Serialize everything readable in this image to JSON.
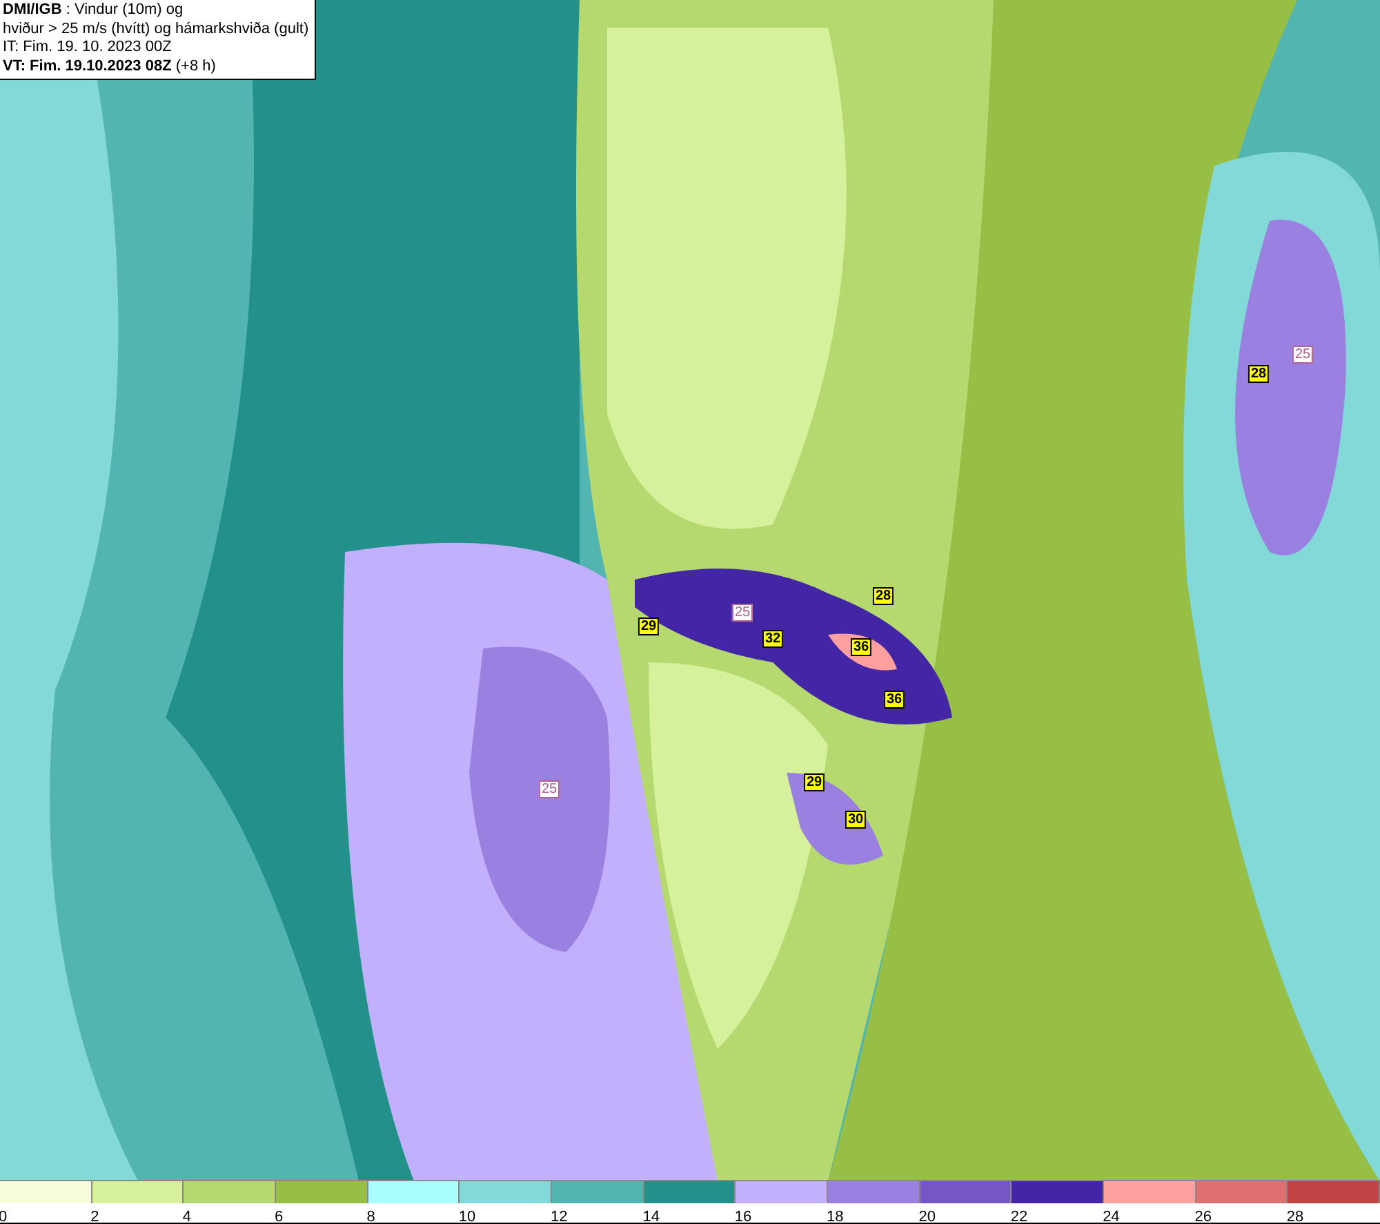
{
  "header": {
    "lines": [
      "**DMI/IGB** : Vindur (10m) og",
      "hviður > 25 m/s (hvítt) og hámarkshviða (gult)",
      "IT: Fim. 19. 10. 2023 00Z",
      "**VT: Fim. 19.10.2023 08Z** (+8 h)"
    ]
  },
  "map": {
    "gust_labels": [
      {
        "kind": "max",
        "text": "28"
      },
      {
        "kind": "gust",
        "text": "25"
      },
      {
        "kind": "max",
        "text": "28"
      },
      {
        "kind": "gust",
        "text": "25"
      },
      {
        "kind": "max",
        "text": "29"
      },
      {
        "kind": "max",
        "text": "32"
      },
      {
        "kind": "max",
        "text": "36"
      },
      {
        "kind": "max",
        "text": "36"
      },
      {
        "kind": "max",
        "text": "29"
      },
      {
        "kind": "gust",
        "text": "25"
      },
      {
        "kind": "max",
        "text": "30"
      }
    ]
  },
  "legend": {
    "swatches": [
      {
        "color": "#f7fcdc"
      },
      {
        "color": "#d7f09c"
      },
      {
        "color": "#b5d96e"
      },
      {
        "color": "#97bf45"
      },
      {
        "color": "#a9fdfc"
      },
      {
        "color": "#83d9d8"
      },
      {
        "color": "#52b5b0"
      },
      {
        "color": "#24908a"
      },
      {
        "color": "#c2b0fc"
      },
      {
        "color": "#9a80e0"
      },
      {
        "color": "#7556c4"
      },
      {
        "color": "#4326a6"
      },
      {
        "color": "#ffa0a0"
      },
      {
        "color": "#e07070"
      },
      {
        "color": "#c04444"
      }
    ],
    "ticks": [
      "0",
      "2",
      "4",
      "6",
      "8",
      "10",
      "12",
      "14",
      "16",
      "18",
      "20",
      "22",
      "24",
      "26",
      "28"
    ]
  }
}
